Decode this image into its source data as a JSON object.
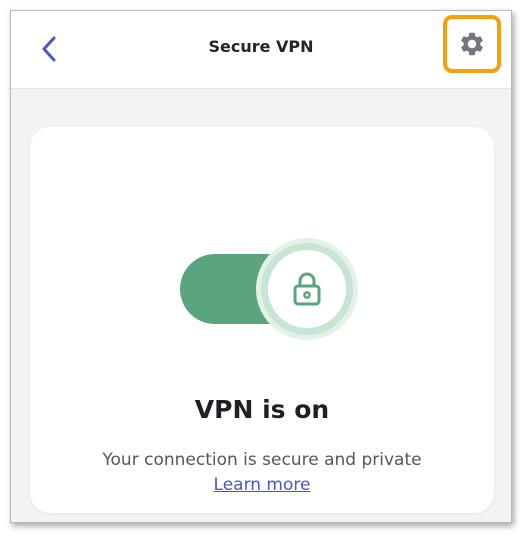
{
  "header": {
    "title": "Secure VPN",
    "back_icon": "chevron-left-icon",
    "settings_icon": "gear-icon"
  },
  "vpn_card": {
    "toggle_state": "on",
    "lock_icon": "lock-icon",
    "status": "VPN is on",
    "description": "Your connection is secure and private",
    "learn_more": "Learn more"
  },
  "colors": {
    "accent_blue": "#4a56c8",
    "toggle_green": "#5aa57d",
    "highlight_orange": "#f5a00c",
    "gear_gray": "#74777f"
  }
}
